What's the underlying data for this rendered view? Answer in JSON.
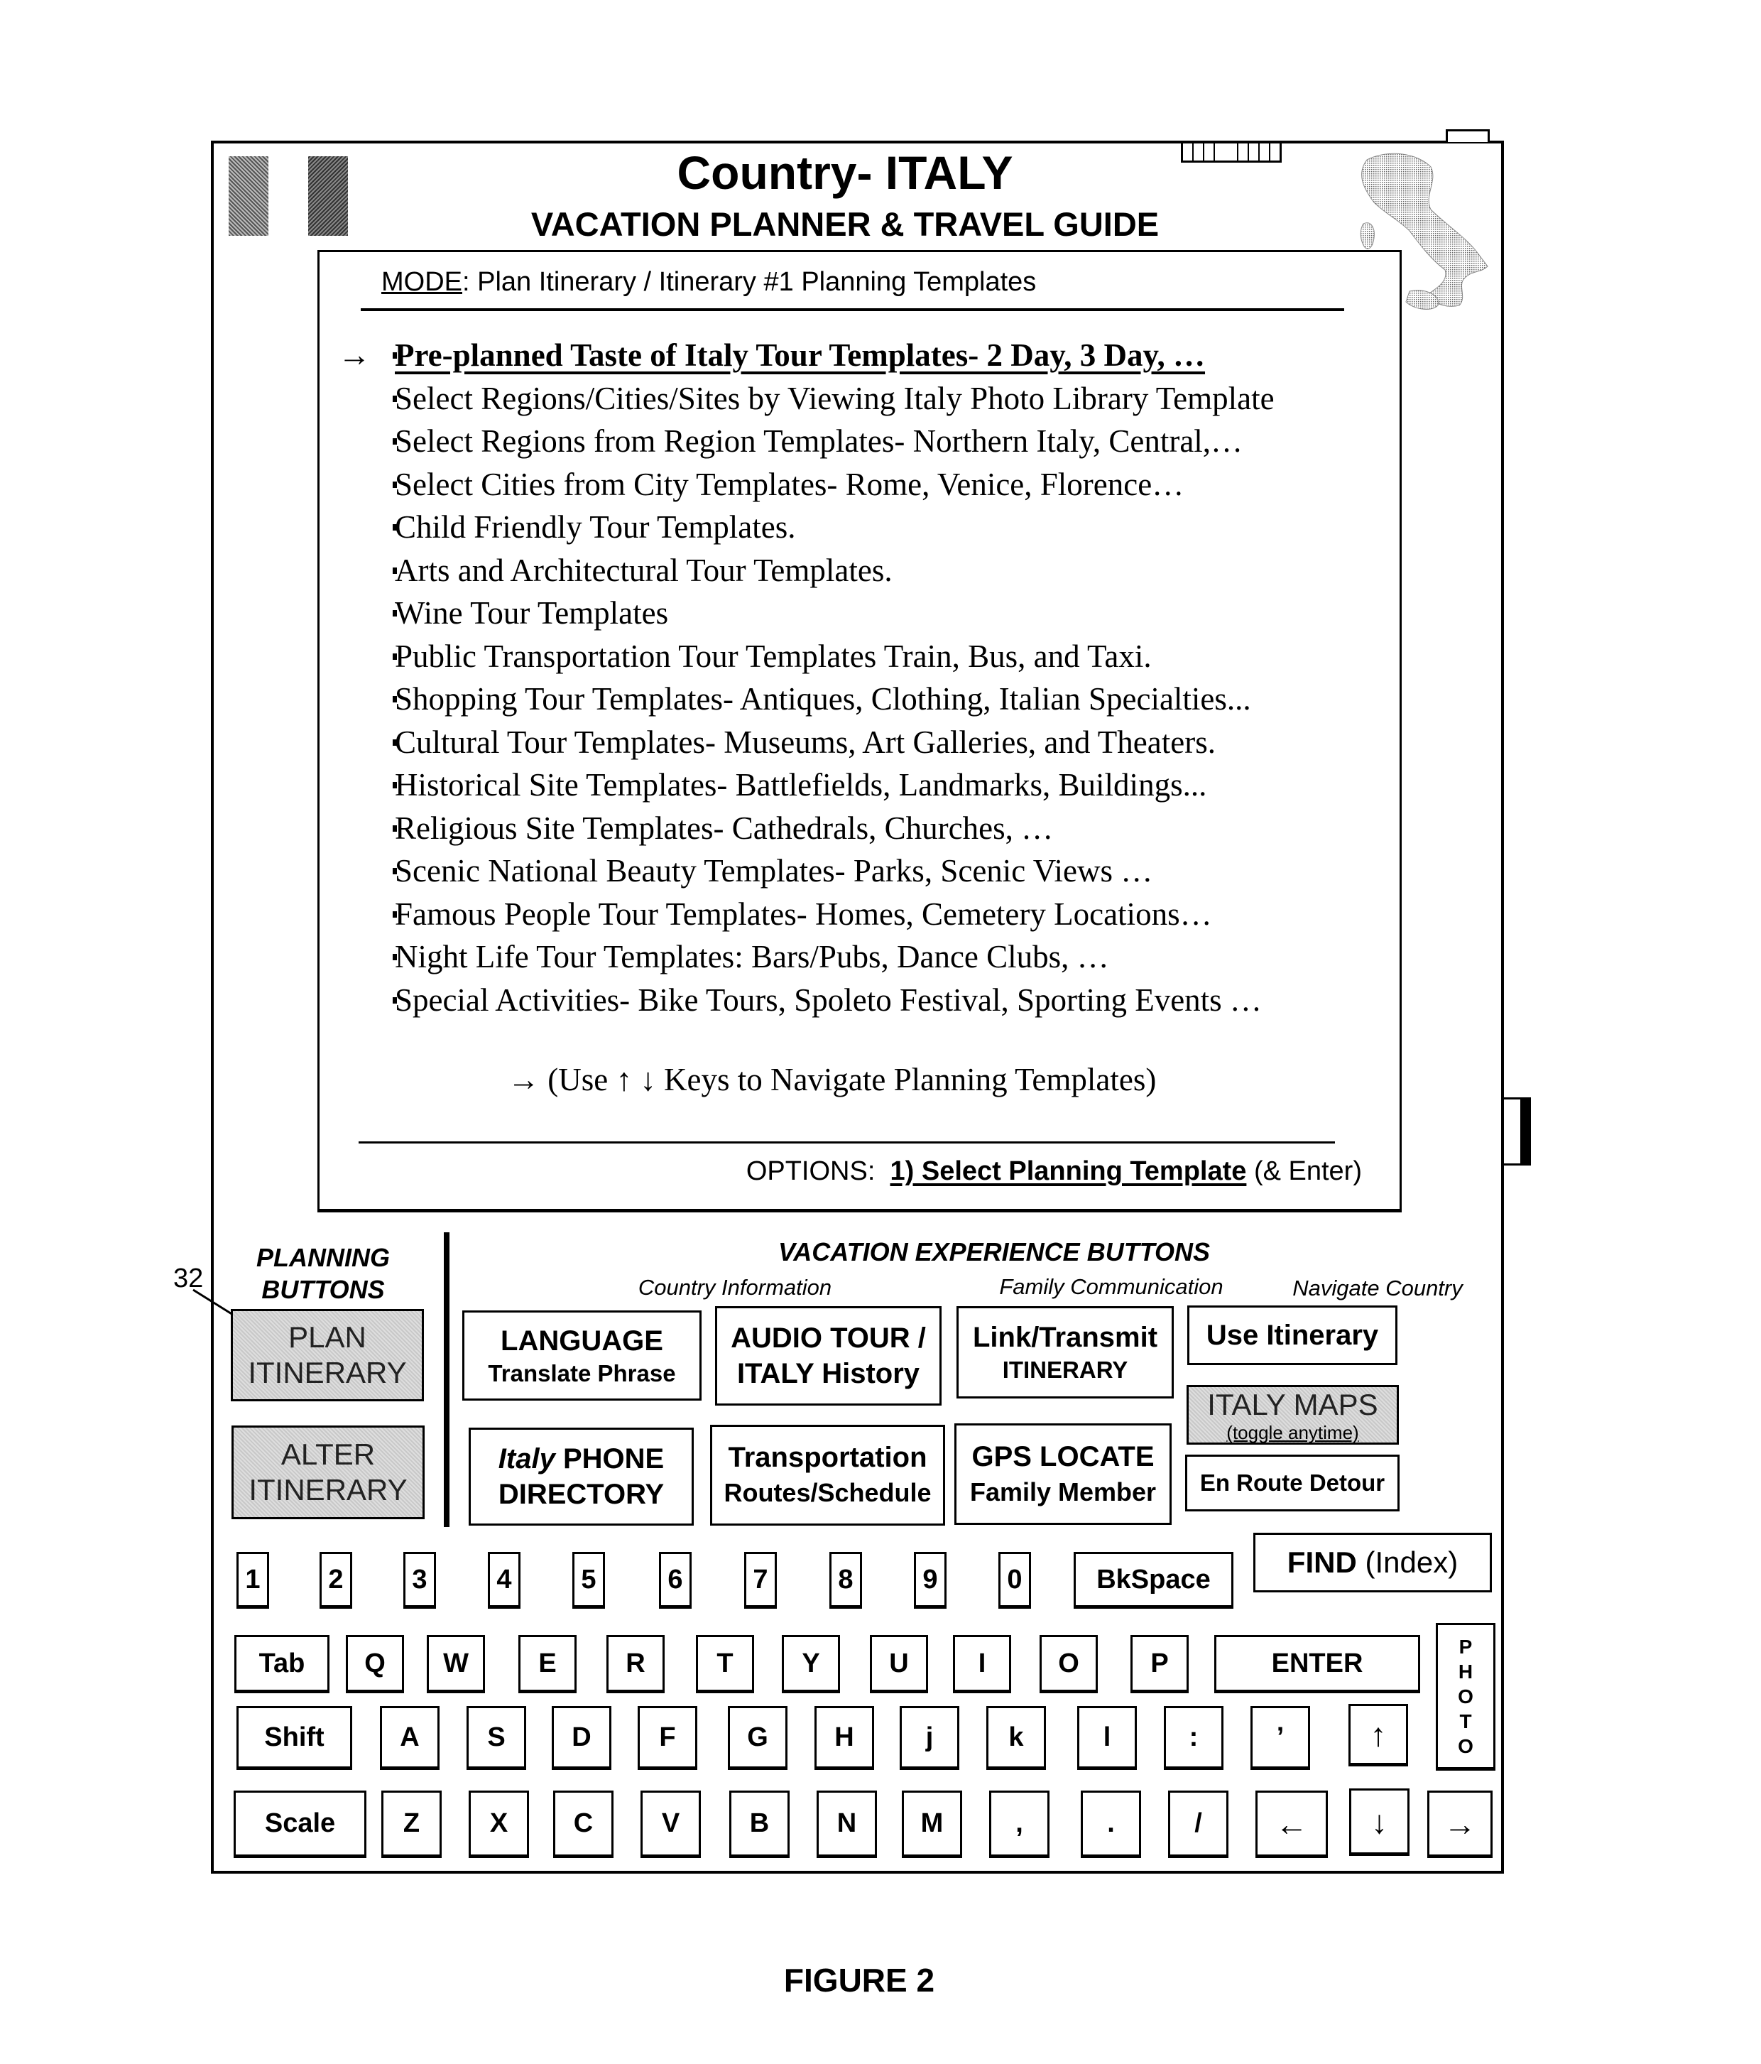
{
  "header": {
    "title": "Country- ITALY",
    "subtitle": "VACATION PLANNER & TRAVEL GUIDE",
    "flag_icon": "italy-flag-icon",
    "map_icon": "italy-map-icon",
    "battery_icon": "battery-indicator-icon"
  },
  "mode": {
    "label": "MODE",
    "text": ": Plan Itinerary / Itinerary #1 Planning Templates"
  },
  "templates": {
    "selected_index": 0,
    "items": [
      "Pre-planned Taste of Italy Tour Templates- 2 Day, 3 Day, …",
      "Select Regions/Cities/Sites by Viewing Italy Photo Library Template",
      "Select Regions from Region Templates- Northern Italy, Central,…",
      "Select Cities from City Templates- Rome, Venice, Florence…",
      "Child Friendly Tour Templates.",
      "Arts and Architectural Tour Templates.",
      "Wine Tour Templates",
      "Public Transportation Tour Templates Train, Bus, and Taxi.",
      "Shopping Tour Templates- Antiques, Clothing, Italian Specialties...",
      "Cultural Tour Templates- Museums, Art Galleries, and Theaters.",
      "Historical Site Templates- Battlefields, Landmarks, Buildings...",
      "Religious Site Templates- Cathedrals, Churches, …",
      "Scenic National Beauty Templates- Parks, Scenic Views …",
      "Famous People Tour Templates- Homes, Cemetery Locations…",
      "Night Life Tour Templates: Bars/Pubs, Dance Clubs, …",
      "Special Activities- Bike Tours, Spoleto Festival, Sporting Events …"
    ],
    "pointer_arrow": "→",
    "nav_hint": "(Use ↑ ↓ Keys to Navigate Planning Templates)"
  },
  "options": {
    "label": "OPTIONS:",
    "option": "1) Select Planning Template",
    "suffix": "(& Enter)"
  },
  "annotation": {
    "reference_number": "32"
  },
  "planning": {
    "heading_line1": "PLANNING",
    "heading_line2": "BUTTONS",
    "buttons": [
      {
        "line1": "PLAN",
        "line2": "ITINERARY"
      },
      {
        "line1": "ALTER",
        "line2": "ITINERARY"
      }
    ]
  },
  "vacation": {
    "heading": "VACATION EXPERIENCE BUTTONS",
    "sections": {
      "country_info": "Country Information",
      "family_comm": "Family Communication",
      "navigate": "Navigate Country"
    },
    "buttons": {
      "language": {
        "line1": "LANGUAGE",
        "line2": "Translate Phrase"
      },
      "audio_tour": {
        "line1": "AUDIO TOUR /",
        "line2": "ITALY History"
      },
      "link_transmit": {
        "line1": "Link/Transmit",
        "line2": "ITINERARY"
      },
      "use_itinerary": {
        "line1": "Use Itinerary"
      },
      "italy_maps": {
        "line1": "ITALY MAPS",
        "line2": "(toggle anytime)"
      },
      "phone_directory": {
        "line1_italic": "Italy",
        "line1": " PHONE",
        "line2": "DIRECTORY"
      },
      "transportation": {
        "line1": "Transportation",
        "line2": "Routes/Schedule"
      },
      "gps_locate": {
        "line1": "GPS LOCATE",
        "line2": "Family Member"
      },
      "en_route": {
        "line1": "En Route Detour"
      }
    }
  },
  "keyboard": {
    "row1": [
      "1",
      "2",
      "3",
      "4",
      "5",
      "6",
      "7",
      "8",
      "9",
      "0",
      "BkSpace"
    ],
    "find": {
      "bold": "FIND",
      "normal": " (Index)"
    },
    "row2": [
      "Tab",
      "Q",
      "W",
      "E",
      "R",
      "T",
      "Y",
      "U",
      "I",
      "O",
      "P",
      "ENTER"
    ],
    "photo": [
      "P",
      "H",
      "O",
      "T",
      "O"
    ],
    "row3": [
      "Shift",
      "A",
      "S",
      "D",
      "F",
      "G",
      "H",
      "j",
      "k",
      "l",
      ":",
      "’",
      "↑"
    ],
    "row4": [
      "Scale",
      "Z",
      "X",
      "C",
      "V",
      "B",
      "N",
      "M",
      ",",
      ".",
      "/",
      "←",
      "↓",
      "→"
    ]
  },
  "caption": "FIGURE 2"
}
